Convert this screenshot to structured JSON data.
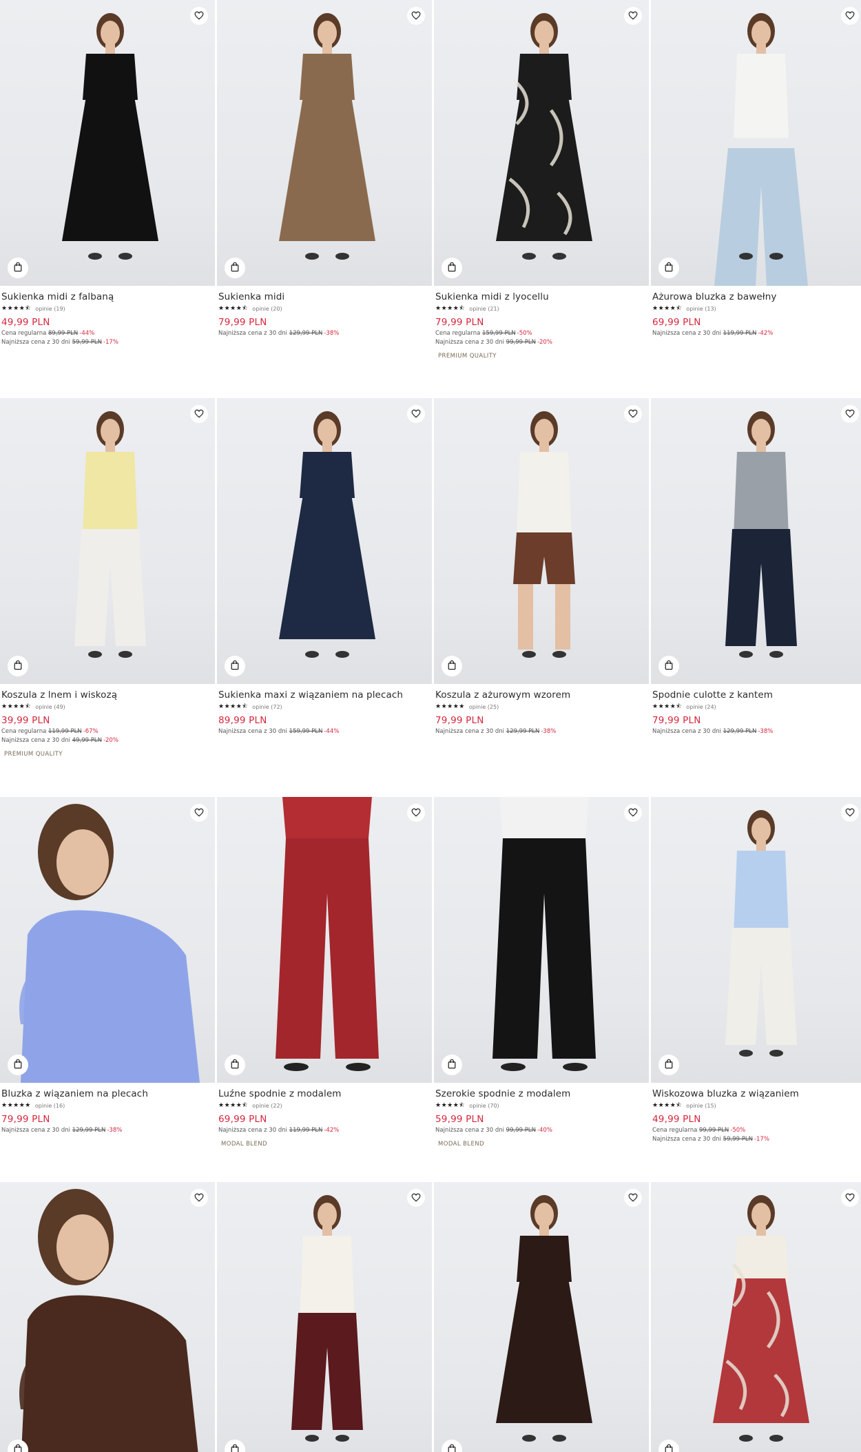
{
  "products": [
    {
      "name": "Sukienka midi z falbaną",
      "rating_stars": "★★★★⯪",
      "reviews": "opinie (19)",
      "price": "49,99 PLN",
      "lines": [
        {
          "label": "Cena regularna",
          "old": "89,99 PLN",
          "disc": "-44%"
        },
        {
          "label": "Najniższa cena z 30 dni",
          "old": "59,99 PLN",
          "disc": "-17%"
        }
      ],
      "tag": ""
    },
    {
      "name": "Sukienka midi",
      "rating_stars": "★★★★⯪",
      "reviews": "opinie (20)",
      "price": "79,99 PLN",
      "lines": [
        {
          "label": "Najniższa cena z 30 dni",
          "old": "129,99 PLN",
          "disc": "-38%"
        }
      ],
      "tag": ""
    },
    {
      "name": "Sukienka midi z lyocellu",
      "rating_stars": "★★★★⯪",
      "reviews": "opinie (21)",
      "price": "79,99 PLN",
      "lines": [
        {
          "label": "Cena regularna",
          "old": "159,99 PLN",
          "disc": "-50%"
        },
        {
          "label": "Najniższa cena z 30 dni",
          "old": "99,99 PLN",
          "disc": "-20%"
        }
      ],
      "tag": "PREMIUM QUALITY"
    },
    {
      "name": "Ażurowa bluzka z bawełny",
      "rating_stars": "★★★★⯪",
      "reviews": "opinie (13)",
      "price": "69,99 PLN",
      "lines": [
        {
          "label": "Najniższa cena z 30 dni",
          "old": "119,99 PLN",
          "disc": "-42%"
        }
      ],
      "tag": ""
    },
    {
      "name": "Koszula z lnem i wiskozą",
      "rating_stars": "★★★★⯪",
      "reviews": "opinie (49)",
      "price": "39,99 PLN",
      "lines": [
        {
          "label": "Cena regularna",
          "old": "119,99 PLN",
          "disc": "-67%"
        },
        {
          "label": "Najniższa cena z 30 dni",
          "old": "49,99 PLN",
          "disc": "-20%"
        }
      ],
      "tag": "PREMIUM QUALITY"
    },
    {
      "name": "Sukienka maxi z wiązaniem na plecach",
      "rating_stars": "★★★★⯪",
      "reviews": "opinie (72)",
      "price": "89,99 PLN",
      "lines": [
        {
          "label": "Najniższa cena z 30 dni",
          "old": "159,99 PLN",
          "disc": "-44%"
        }
      ],
      "tag": ""
    },
    {
      "name": "Koszula z ażurowym wzorem",
      "rating_stars": "★★★★★",
      "reviews": "opinie (25)",
      "price": "79,99 PLN",
      "lines": [
        {
          "label": "Najniższa cena z 30 dni",
          "old": "129,99 PLN",
          "disc": "-38%"
        }
      ],
      "tag": ""
    },
    {
      "name": "Spodnie culotte z kantem",
      "rating_stars": "★★★★⯪",
      "reviews": "opinie (24)",
      "price": "79,99 PLN",
      "lines": [
        {
          "label": "Najniższa cena z 30 dni",
          "old": "129,99 PLN",
          "disc": "-38%"
        }
      ],
      "tag": ""
    },
    {
      "name": "Bluzka z wiązaniem na plecach",
      "rating_stars": "★★★★★",
      "reviews": "opinie (16)",
      "price": "79,99 PLN",
      "lines": [
        {
          "label": "Najniższa cena z 30 dni",
          "old": "129,99 PLN",
          "disc": "-38%"
        }
      ],
      "tag": ""
    },
    {
      "name": "Luźne spodnie z modalem",
      "rating_stars": "★★★★⯪",
      "reviews": "opinie (22)",
      "price": "69,99 PLN",
      "lines": [
        {
          "label": "Najniższa cena z 30 dni",
          "old": "119,99 PLN",
          "disc": "-42%"
        }
      ],
      "tag": "MODAL BLEND"
    },
    {
      "name": "Szerokie spodnie z modalem",
      "rating_stars": "★★★★⯪",
      "reviews": "opinie (70)",
      "price": "59,99 PLN",
      "lines": [
        {
          "label": "Najniższa cena z 30 dni",
          "old": "99,99 PLN",
          "disc": "-40%"
        }
      ],
      "tag": "MODAL BLEND"
    },
    {
      "name": "Wiskozowa bluzka z wiązaniem",
      "rating_stars": "★★★★⯪",
      "reviews": "opinie (15)",
      "price": "49,99 PLN",
      "lines": [
        {
          "label": "Cena regularna",
          "old": "99,99 PLN",
          "disc": "-50%"
        },
        {
          "label": "Najniższa cena z 30 dni",
          "old": "59,99 PLN",
          "disc": "-17%"
        }
      ],
      "tag": ""
    },
    {
      "name": "",
      "rating_stars": "",
      "reviews": "",
      "price": "",
      "lines": [],
      "tag": ""
    },
    {
      "name": "",
      "rating_stars": "",
      "reviews": "",
      "price": "",
      "lines": [],
      "tag": ""
    },
    {
      "name": "",
      "rating_stars": "",
      "reviews": "",
      "price": "",
      "lines": [],
      "tag": ""
    },
    {
      "name": "",
      "rating_stars": "",
      "reviews": "",
      "price": "",
      "lines": [],
      "tag": ""
    }
  ],
  "garments": [
    {
      "top": "#111111",
      "bottom": "#111111",
      "style": "dress"
    },
    {
      "top": "#8a6a4e",
      "bottom": "#8a6a4e",
      "style": "dress"
    },
    {
      "top": "#1c1c1c",
      "bottom": "#1c1c1c",
      "style": "dress-print"
    },
    {
      "top": "#f4f4f2",
      "bottom": "#b9cde0",
      "style": "top-jeans"
    },
    {
      "top": "#efe7a3",
      "bottom": "#efeeea",
      "style": "top-pants"
    },
    {
      "top": "#1e2a44",
      "bottom": "#1e2a44",
      "style": "dress"
    },
    {
      "top": "#f3f1ec",
      "bottom": "#6b3d2a",
      "style": "top-shorts"
    },
    {
      "top": "#9aa0a8",
      "bottom": "#1c2438",
      "style": "top-pants"
    },
    {
      "top": "#8fa4e8",
      "bottom": "#8fa4e8",
      "style": "closeup"
    },
    {
      "top": "#b32d33",
      "bottom": "#a3262c",
      "style": "pants-only"
    },
    {
      "top": "#f2f2f2",
      "bottom": "#141414",
      "style": "pants-only"
    },
    {
      "top": "#b7cfee",
      "bottom": "#f0eee9",
      "style": "top-pants"
    },
    {
      "top": "#4a2a1e",
      "bottom": "#141414",
      "style": "closeup"
    },
    {
      "top": "#f3f1ea",
      "bottom": "#5a1a1e",
      "style": "top-pants"
    },
    {
      "top": "#2b1a16",
      "bottom": "#2b1a16",
      "style": "dress"
    },
    {
      "top": "#f1ece4",
      "bottom": "#b2383c",
      "style": "dress-print"
    }
  ]
}
